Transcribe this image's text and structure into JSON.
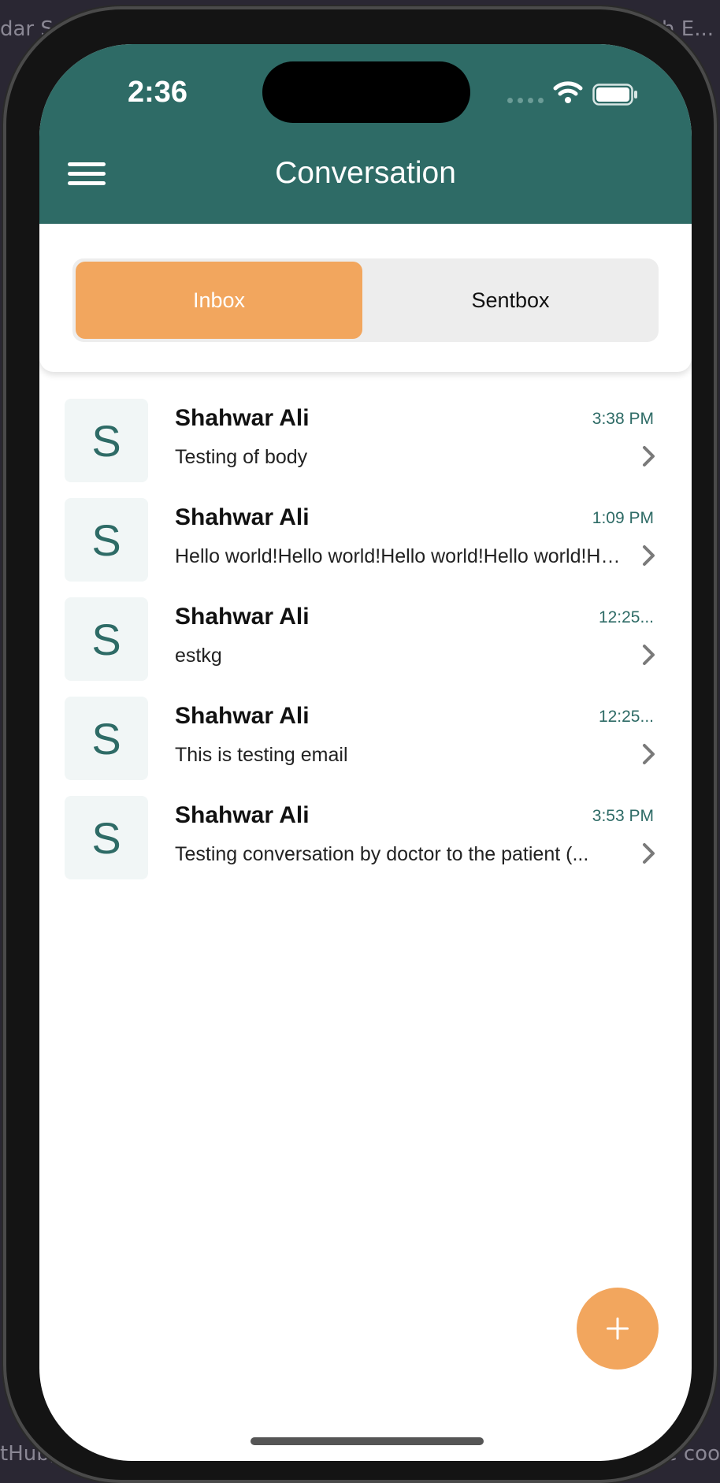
{
  "backdrop": {
    "top_left": "dar Sc",
    "top_right": "h E...",
    "bottom_left": "tHub,",
    "bottom_right": "ge coo"
  },
  "status_bar": {
    "time": "2:36"
  },
  "header": {
    "title": "Conversation"
  },
  "tabs": [
    {
      "label": "Inbox",
      "selected": true
    },
    {
      "label": "Sentbox",
      "selected": false
    }
  ],
  "messages": [
    {
      "avatar_letter": "S",
      "sender": "Shahwar Ali",
      "time": "3:38 PM",
      "preview": "Testing of body"
    },
    {
      "avatar_letter": "S",
      "sender": "Shahwar Ali",
      "time": "1:09 PM",
      "preview": "Hello world!Hello world!Hello world!Hello world!Hello world!"
    },
    {
      "avatar_letter": "S",
      "sender": "Shahwar Ali",
      "time": "12:25...",
      "preview": "estkg"
    },
    {
      "avatar_letter": "S",
      "sender": "Shahwar Ali",
      "time": "12:25...",
      "preview": "This is testing email"
    },
    {
      "avatar_letter": "S",
      "sender": "Shahwar Ali",
      "time": "3:53 PM",
      "preview": "Testing conversation by doctor to the patient (..."
    }
  ],
  "colors": {
    "header": "#2e6b66",
    "accent": "#f2a65e",
    "segment_bg": "#ededed",
    "avatar_bg": "#f1f6f6"
  },
  "icons": {
    "menu": "hamburger-icon",
    "row_action": "chevron-right-icon",
    "compose": "plus-icon"
  }
}
